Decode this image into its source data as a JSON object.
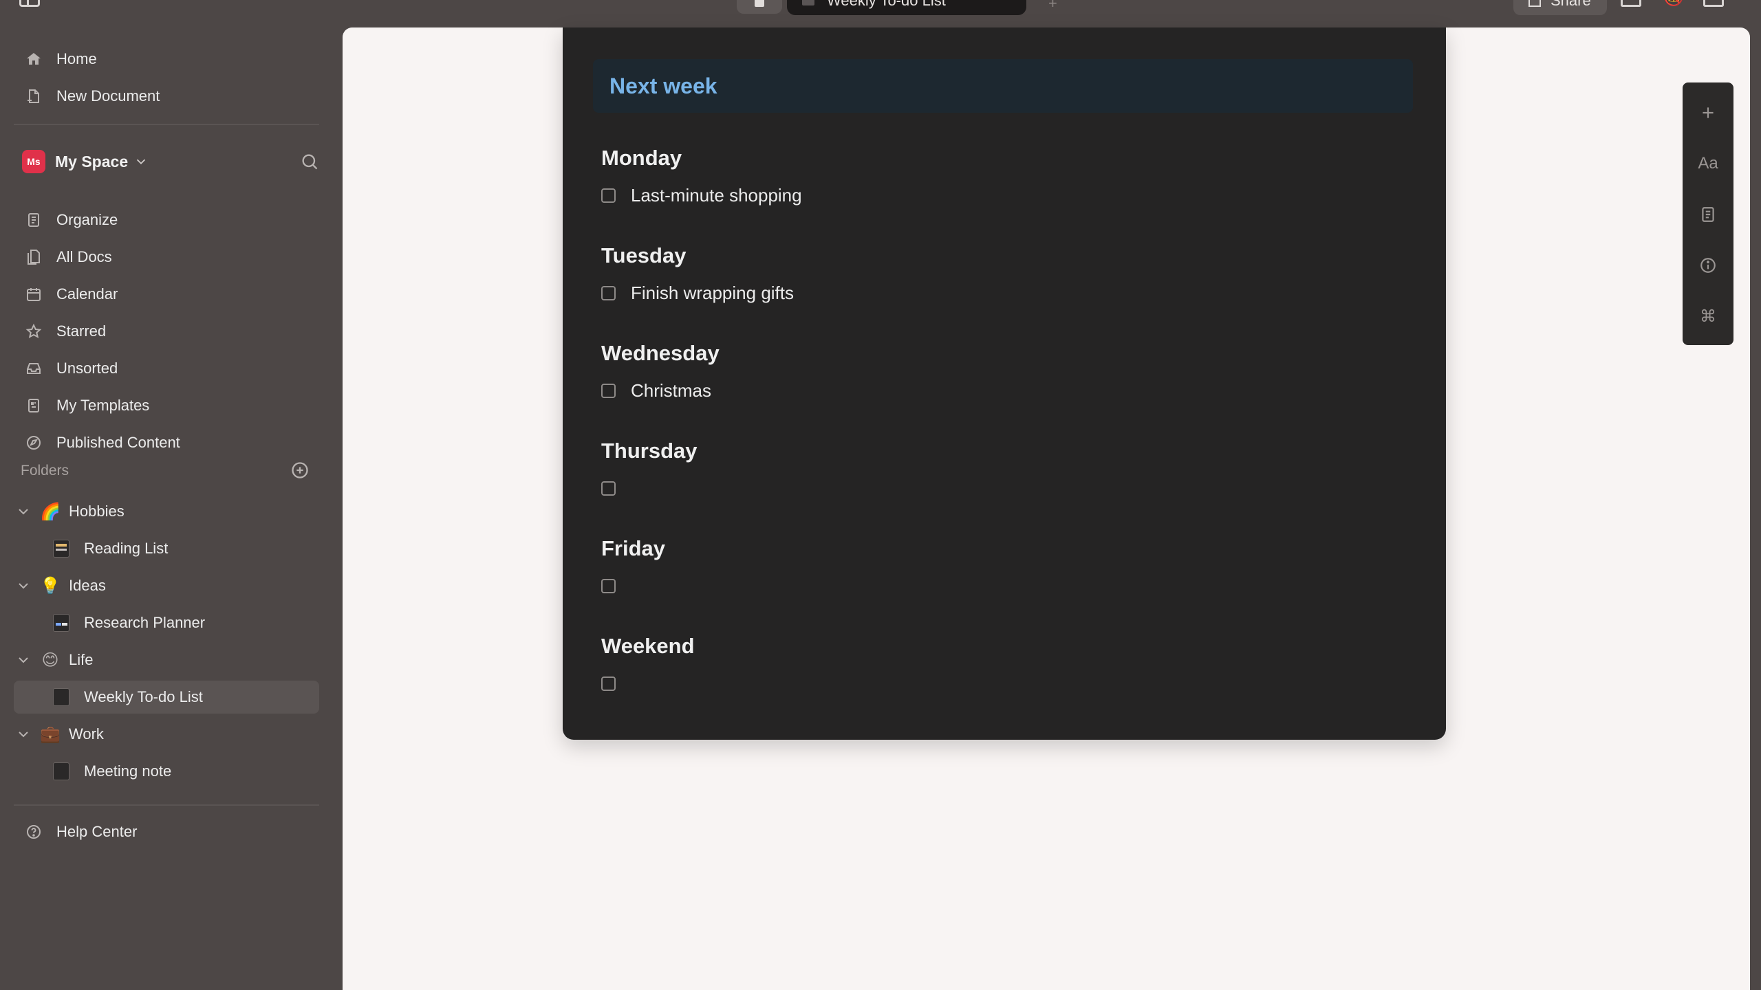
{
  "topbar": {
    "tab_title": "Weekly To-do List",
    "share_label": "Share"
  },
  "sidebar": {
    "top_items": [
      {
        "label": "Home",
        "icon": "home-icon"
      },
      {
        "label": "New Document",
        "icon": "new-document-icon"
      }
    ],
    "space": {
      "badge": "Ms",
      "name": "My Space"
    },
    "space_items": [
      {
        "label": "Organize",
        "icon": "organize-icon"
      },
      {
        "label": "All Docs",
        "icon": "all-docs-icon"
      },
      {
        "label": "Calendar",
        "icon": "calendar-icon"
      },
      {
        "label": "Starred",
        "icon": "star-icon"
      },
      {
        "label": "Unsorted",
        "icon": "inbox-icon"
      },
      {
        "label": "My Templates",
        "icon": "template-icon"
      },
      {
        "label": "Published Content",
        "icon": "published-icon"
      }
    ],
    "folders_label": "Folders",
    "folders": [
      {
        "label": "Hobbies",
        "emoji": "🌈",
        "children": [
          {
            "label": "Reading List"
          }
        ]
      },
      {
        "label": "Ideas",
        "emoji": "💡",
        "children": [
          {
            "label": "Research Planner"
          }
        ]
      },
      {
        "label": "Life",
        "emoji": "😊",
        "children": [
          {
            "label": "Weekly To-do List",
            "selected": true
          }
        ]
      },
      {
        "label": "Work",
        "emoji": "💼",
        "children": [
          {
            "label": "Meeting note"
          }
        ]
      }
    ],
    "help_label": "Help Center"
  },
  "document": {
    "callout": "Next week",
    "days": [
      {
        "heading": "Monday",
        "task": "Last-minute shopping",
        "checked": false
      },
      {
        "heading": "Tuesday",
        "task": "Finish wrapping gifts",
        "checked": false
      },
      {
        "heading": "Wednesday",
        "task": "Christmas",
        "checked": false
      },
      {
        "heading": "Thursday",
        "task": "",
        "checked": false
      },
      {
        "heading": "Friday",
        "task": "",
        "checked": false
      },
      {
        "heading": "Weekend",
        "task": "",
        "checked": false
      }
    ]
  },
  "right_toolbar": {
    "font_label": "Aa",
    "command_label": "⌘"
  },
  "colors": {
    "sidebar_bg": "#4d4746",
    "content_bg": "#f8f4f3",
    "doc_bg": "#252424",
    "callout_bg": "#1d2830",
    "callout_text": "#78b4e8",
    "space_badge": "#e0314a"
  }
}
